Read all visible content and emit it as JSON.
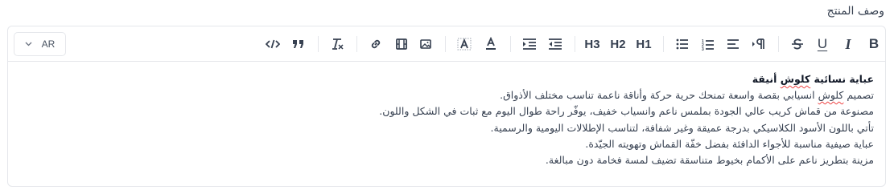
{
  "field": {
    "label": "وصف المنتج"
  },
  "language_select": {
    "value": "AR"
  },
  "toolbar": {
    "bold": "B",
    "italic": "I",
    "underline": "U",
    "h1": "H1",
    "h2": "H2",
    "h3": "H3"
  },
  "content": {
    "title": "عباية نسائية كلوش أنيقة",
    "lines": [
      {
        "before": "تصميم ",
        "misspelled": "كلوش",
        "after": " انسيابي بقصة واسعة تمنحك حرية حركة وأناقة ناعمة تناسب مختلف الأذواق."
      },
      {
        "text": "مصنوعة من قماش كريب عالي الجودة بملمس ناعم وانسياب خفيف، يوفّر راحة طوال اليوم مع ثبات في الشكل واللون."
      },
      {
        "text": "تأتي باللون الأسود الكلاسيكي بدرجة عميقة وغير شفافة، لتناسب الإطلالات اليومية والرسمية."
      },
      {
        "text": "عباية صيفية مناسبة للأجواء الدافئة بفضل خفّة القماش وتهويته الجيّدة."
      },
      {
        "text": "مزينة بتطريز ناعم على الأكمام بخيوط متناسقة تضيف لمسة فخامة دون مبالغة."
      }
    ]
  }
}
